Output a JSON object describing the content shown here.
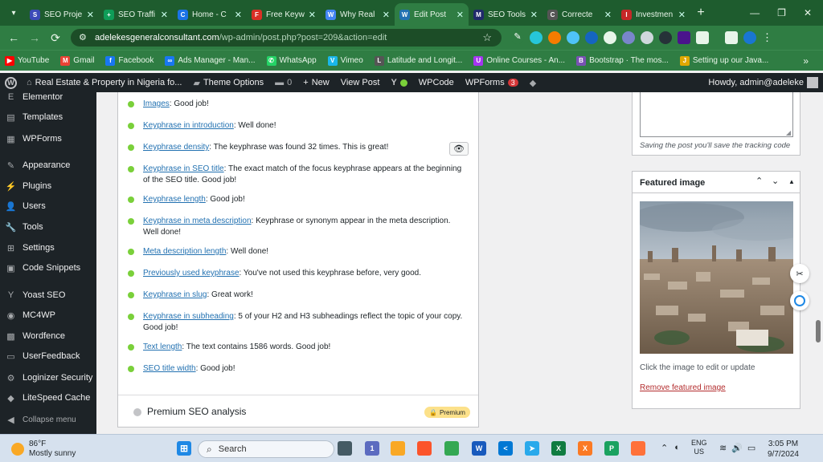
{
  "browser": {
    "tabs": [
      {
        "title": "SEO Proje",
        "color": "#3c4ab8",
        "glyph": "S"
      },
      {
        "title": "SEO Traffi",
        "color": "#0f9d58",
        "glyph": "+"
      },
      {
        "title": "Home - C",
        "color": "#1a73e8",
        "glyph": "C"
      },
      {
        "title": "Free Keyw",
        "color": "#d93025",
        "glyph": "F"
      },
      {
        "title": "Why Real",
        "color": "#4285f4",
        "glyph": "W"
      },
      {
        "title": "Edit Post",
        "color": "#2271b1",
        "glyph": "W"
      },
      {
        "title": "SEO Tools",
        "color": "#202a6b",
        "glyph": "M"
      },
      {
        "title": "Correcte",
        "color": "#555555",
        "glyph": "C"
      },
      {
        "title": "Investmen",
        "color": "#c62828",
        "glyph": "I"
      }
    ],
    "url_domain": "adelekesgeneralconsultant.com",
    "url_path": "/wp-admin/post.php?post=209&action=edit",
    "bookmarks": [
      {
        "label": "YouTube",
        "color": "#ff0000",
        "glyph": "▶"
      },
      {
        "label": "Gmail",
        "color": "#ea4335",
        "glyph": "M"
      },
      {
        "label": "Facebook",
        "color": "#1877f2",
        "glyph": "f"
      },
      {
        "label": "Ads Manager - Man...",
        "color": "#1877f2",
        "glyph": "∞"
      },
      {
        "label": "WhatsApp",
        "color": "#25d366",
        "glyph": "✆"
      },
      {
        "label": "Vimeo",
        "color": "#1ab7ea",
        "glyph": "V"
      },
      {
        "label": "Latitude and Longit...",
        "color": "#555555",
        "glyph": "L"
      },
      {
        "label": "Online Courses - An...",
        "color": "#a435f0",
        "glyph": "U"
      },
      {
        "label": "Bootstrap · The mos...",
        "color": "#7952b3",
        "glyph": "B"
      },
      {
        "label": "Setting up our Java...",
        "color": "#e0a800",
        "glyph": "J"
      }
    ]
  },
  "adminbar": {
    "site": "Real Estate & Property in Nigeria fo...",
    "theme_options": "Theme Options",
    "comments": "0",
    "new": "New",
    "view_post": "View Post",
    "wpcode": "WPCode",
    "wpforms": "WPForms",
    "wpforms_badge": "3",
    "howdy": "Howdy, admin@adeleke"
  },
  "sidebar": {
    "items": [
      {
        "label": "Elementor",
        "icon": "E"
      },
      {
        "label": "Templates",
        "icon": "▤"
      },
      {
        "label": "WPForms",
        "icon": "▦"
      },
      {
        "label": "Appearance",
        "icon": "✎"
      },
      {
        "label": "Plugins",
        "icon": "⚡"
      },
      {
        "label": "Users",
        "icon": "👤"
      },
      {
        "label": "Tools",
        "icon": "🔧"
      },
      {
        "label": "Settings",
        "icon": "⊞"
      },
      {
        "label": "Code Snippets",
        "icon": "▣"
      },
      {
        "label": "Yoast SEO",
        "icon": "Y"
      },
      {
        "label": "MC4WP",
        "icon": "◉"
      },
      {
        "label": "Wordfence",
        "icon": "▩"
      },
      {
        "label": "UserFeedback",
        "icon": "▭"
      },
      {
        "label": "Loginizer Security",
        "icon": "⚙"
      },
      {
        "label": "LiteSpeed Cache",
        "icon": "◆"
      },
      {
        "label": "Collapse menu",
        "icon": "◀"
      }
    ]
  },
  "seo_checks": [
    {
      "link": "Images",
      "text": ": Good job!"
    },
    {
      "link": "Keyphrase in introduction",
      "text": ": Well done!"
    },
    {
      "link": "Keyphrase density",
      "text": ": The keyphrase was found 32 times. This is great!"
    },
    {
      "link": "Keyphrase in SEO title",
      "text": ": The exact match of the focus keyphrase appears at the beginning of the SEO title. Good job!"
    },
    {
      "link": "Keyphrase length",
      "text": ": Good job!"
    },
    {
      "link": "Keyphrase in meta description",
      "text": ": Keyphrase or synonym appear in the meta description. Well done!"
    },
    {
      "link": "Meta description length",
      "text": ": Well done!"
    },
    {
      "link": "Previously used keyphrase",
      "text": ": You've not used this keyphrase before, very good."
    },
    {
      "link": "Keyphrase in slug",
      "text": ": Great work!"
    },
    {
      "link": "Keyphrase in subheading",
      "text": ": 5 of your H2 and H3 subheadings reflect the topic of your copy. Good job!"
    },
    {
      "link": "Text length",
      "text": ": The text contains 1586 words. Good job!"
    },
    {
      "link": "SEO title width",
      "text": ": Good job!"
    }
  ],
  "premium": {
    "label": "Premium SEO analysis",
    "badge": "Premium"
  },
  "tracking": {
    "note": "Saving the post you'll save the tracking code"
  },
  "featured": {
    "title": "Featured image",
    "edit_hint": "Click the image to edit or update",
    "remove": "Remove featured image"
  },
  "taskbar": {
    "temp": "86°F",
    "weather": "Mostly sunny",
    "search": "Search",
    "lang1": "ENG",
    "lang2": "US",
    "time": "3:05 PM",
    "date": "9/7/2024"
  }
}
